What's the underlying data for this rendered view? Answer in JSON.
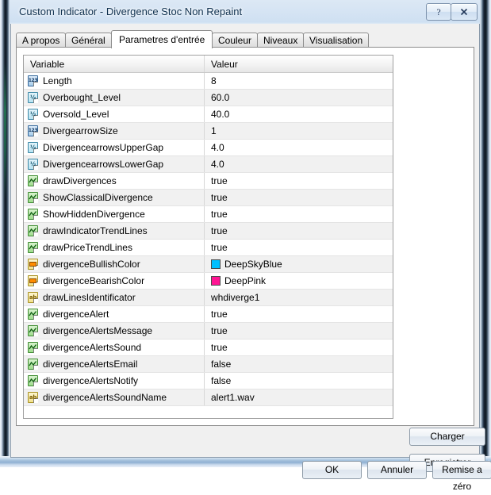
{
  "window": {
    "title": "Custom Indicator - Divergence Stoc Non Repaint",
    "help_button": "?",
    "close_button": "X",
    "help_icon": "question-mark-icon",
    "close_icon": "close-x-icon"
  },
  "tabs": [
    {
      "label": "A propos",
      "active": false
    },
    {
      "label": "Général",
      "active": false
    },
    {
      "label": "Parametres d'entrée",
      "active": true
    },
    {
      "label": "Couleur",
      "active": false
    },
    {
      "label": "Niveaux",
      "active": false
    },
    {
      "label": "Visualisation",
      "active": false
    }
  ],
  "table": {
    "columns": [
      "Variable",
      "Valeur"
    ],
    "rows": [
      {
        "icon": "int",
        "icon_label": "123",
        "name": "Length",
        "value": "8"
      },
      {
        "icon": "dbl",
        "icon_label": "½",
        "name": "Overbought_Level",
        "value": "60.0"
      },
      {
        "icon": "dbl",
        "icon_label": "½",
        "name": "Oversold_Level",
        "value": "40.0"
      },
      {
        "icon": "int",
        "icon_label": "123",
        "name": "DivergearrowSize",
        "value": "1"
      },
      {
        "icon": "dbl",
        "icon_label": "½",
        "name": "DivergencearrowsUpperGap",
        "value": "4.0"
      },
      {
        "icon": "dbl",
        "icon_label": "½",
        "name": "DivergencearrowsLowerGap",
        "value": "4.0"
      },
      {
        "icon": "bool",
        "icon_label": "",
        "name": "drawDivergences",
        "value": "true"
      },
      {
        "icon": "bool",
        "icon_label": "",
        "name": "ShowClassicalDivergence",
        "value": "true"
      },
      {
        "icon": "bool",
        "icon_label": "",
        "name": "ShowHiddenDivergence",
        "value": "true"
      },
      {
        "icon": "bool",
        "icon_label": "",
        "name": "drawIndicatorTrendLines",
        "value": "true"
      },
      {
        "icon": "bool",
        "icon_label": "",
        "name": "drawPriceTrendLines",
        "value": "true"
      },
      {
        "icon": "col",
        "icon_label": "",
        "name": "divergenceBullishColor",
        "value": "DeepSkyBlue",
        "swatch": "#00BFFF"
      },
      {
        "icon": "col",
        "icon_label": "",
        "name": "divergenceBearishColor",
        "value": "DeepPink",
        "swatch": "#FF1493"
      },
      {
        "icon": "str",
        "icon_label": "ab",
        "name": "drawLinesIdentificator",
        "value": "whdiverge1"
      },
      {
        "icon": "bool",
        "icon_label": "",
        "name": "divergenceAlert",
        "value": "true"
      },
      {
        "icon": "bool",
        "icon_label": "",
        "name": "divergenceAlertsMessage",
        "value": "true"
      },
      {
        "icon": "bool",
        "icon_label": "",
        "name": "divergenceAlertsSound",
        "value": "true"
      },
      {
        "icon": "bool",
        "icon_label": "",
        "name": "divergenceAlertsEmail",
        "value": "false"
      },
      {
        "icon": "bool",
        "icon_label": "",
        "name": "divergenceAlertsNotify",
        "value": "false"
      },
      {
        "icon": "str",
        "icon_label": "ab",
        "name": "divergenceAlertsSoundName",
        "value": "alert1.wav"
      }
    ]
  },
  "side_buttons": {
    "load": "Charger",
    "save": "Enregistrer"
  },
  "bottom_buttons": {
    "ok": "OK",
    "cancel": "Annuler",
    "reset": "Remise a zéro"
  },
  "colors": {
    "deep_sky_blue": "#00BFFF",
    "deep_pink": "#FF1493",
    "title_text": "#10314F",
    "row_alt": "#F1F1F1"
  }
}
